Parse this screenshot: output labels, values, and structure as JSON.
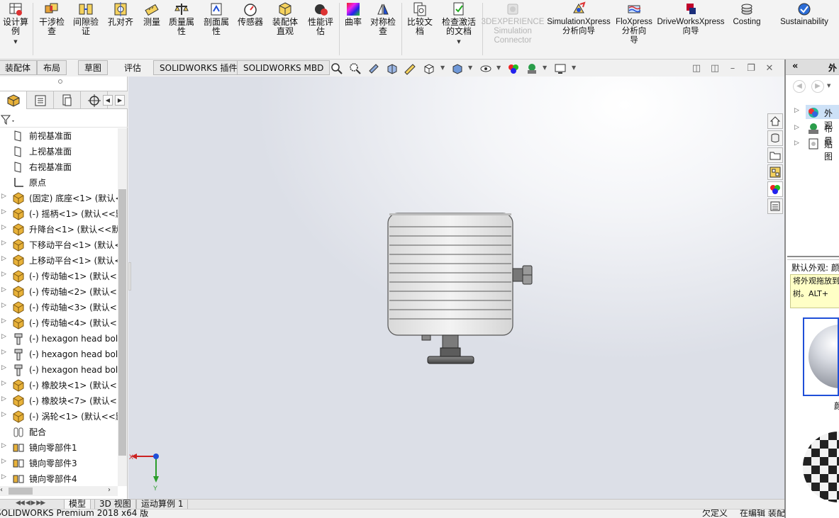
{
  "ribbon": {
    "buttons": [
      {
        "label": "设计算\n例",
        "icon": "design-table-icon"
      },
      {
        "label": "干涉检\n查",
        "icon": "interference-check-icon"
      },
      {
        "label": "间隙验\n证",
        "icon": "clearance-verification-icon"
      },
      {
        "label": "孔对齐",
        "icon": "hole-alignment-icon"
      },
      {
        "label": "测量",
        "icon": "measure-icon"
      },
      {
        "label": "质量属\n性",
        "icon": "mass-properties-icon"
      },
      {
        "label": "剖面属\n性",
        "icon": "section-properties-icon"
      },
      {
        "label": "传感器",
        "icon": "sensor-icon"
      },
      {
        "label": "装配体\n直观",
        "icon": "assemblyxpert-icon"
      },
      {
        "label": "性能评\n估",
        "icon": "performance-evaluation-icon"
      },
      {
        "label": "曲率",
        "icon": "curvature-icon"
      },
      {
        "label": "对称检\n查",
        "icon": "symmetry-check-icon"
      },
      {
        "label": "比较文\n档",
        "icon": "compare-documents-icon"
      },
      {
        "label": "检查激活\n的文档",
        "icon": "check-active-document-icon"
      },
      {
        "label": "3DEXPERIENCE\nSimulation\nConnector",
        "icon": "3dexperience-icon"
      },
      {
        "label": "SimulationXpress\n分析向导",
        "icon": "simulationxpress-icon"
      },
      {
        "label": "FloXpress\n分析向\n导",
        "icon": "floxpress-icon"
      },
      {
        "label": "DriveWorksXpress\n向导",
        "icon": "driveworksxpress-icon"
      },
      {
        "label": "Costing",
        "icon": "costing-icon"
      },
      {
        "label": "Sustainability",
        "icon": "sustainability-icon"
      }
    ]
  },
  "tabs": [
    "装配体",
    "布局",
    "草图",
    "评估",
    "SOLIDWORKS 插件",
    "SOLIDWORKS MBD"
  ],
  "active_tab": "评估",
  "tree": {
    "items": [
      {
        "label": "前视基准面",
        "icon": "plane-icon",
        "expandable": false
      },
      {
        "label": "上视基准面",
        "icon": "plane-icon",
        "expandable": false
      },
      {
        "label": "右视基准面",
        "icon": "plane-icon",
        "expandable": false
      },
      {
        "label": "原点",
        "icon": "origin-icon",
        "expandable": false
      },
      {
        "label": "(固定) 底座<1> (默认<",
        "icon": "part-icon",
        "expandable": true
      },
      {
        "label": "(-) 摇柄<1> (默认<<默",
        "icon": "part-icon",
        "expandable": true
      },
      {
        "label": "升降台<1> (默认<<默",
        "icon": "part-icon",
        "expandable": true
      },
      {
        "label": "下移动平台<1> (默认<",
        "icon": "part-icon",
        "expandable": true
      },
      {
        "label": "上移动平台<1> (默认<",
        "icon": "part-icon",
        "expandable": true
      },
      {
        "label": "(-) 传动轴<1> (默认<<",
        "icon": "part-icon",
        "expandable": true
      },
      {
        "label": "(-) 传动轴<2> (默认<<",
        "icon": "part-icon",
        "expandable": true
      },
      {
        "label": "(-) 传动轴<3> (默认<<",
        "icon": "part-icon",
        "expandable": true
      },
      {
        "label": "(-) 传动轴<4> (默认<<",
        "icon": "part-icon",
        "expandable": true
      },
      {
        "label": "(-) hexagon head bol",
        "icon": "bolt-icon",
        "expandable": true
      },
      {
        "label": "(-) hexagon head bol",
        "icon": "bolt-icon",
        "expandable": true
      },
      {
        "label": "(-) hexagon head bol",
        "icon": "bolt-icon",
        "expandable": true
      },
      {
        "label": "(-) 橡胶块<1> (默认<<",
        "icon": "part-icon",
        "expandable": true
      },
      {
        "label": "(-) 橡胶块<7> (默认<<",
        "icon": "part-icon",
        "expandable": true
      },
      {
        "label": "(-) 涡轮<1> (默认<<默",
        "icon": "part-icon",
        "expandable": true
      },
      {
        "label": "配合",
        "icon": "mates-icon",
        "expandable": false
      },
      {
        "label": "镜向零部件1",
        "icon": "mirror-component-icon",
        "expandable": true
      },
      {
        "label": "镜向零部件3",
        "icon": "mirror-component-icon",
        "expandable": true
      },
      {
        "label": "镜向零部件4",
        "icon": "mirror-component-icon",
        "expandable": true
      }
    ]
  },
  "triad": {
    "x_label": "X",
    "y_label": "Y"
  },
  "right_panel": {
    "title": "外",
    "items": [
      "外观",
      "布景",
      "贴图"
    ],
    "section_label": "默认外观: 颜",
    "tooltip_line1": "将外观拖放到",
    "tooltip_line2": "树。ALT+",
    "swatch_label": "颜"
  },
  "bottom_tabs": [
    "模型",
    "3D 视图",
    "运动算例 1"
  ],
  "active_bottom_tab": "模型",
  "status": {
    "app": "SOLIDWORKS Premium 2018 x64 版",
    "units": "欠定义",
    "mode": "在编辑 装配体"
  },
  "colors": {
    "accent_blue": "#1f4fd8",
    "part_yellow": "#e8b23a",
    "tooltip_yellow": "#ffffc6"
  }
}
